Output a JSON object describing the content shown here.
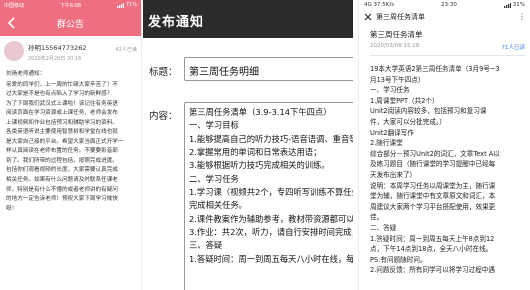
{
  "panel1": {
    "status": {
      "carrier": "中国移动",
      "time": "下午6:08",
      "battery": "71%"
    },
    "title": "群公告",
    "author": {
      "name": "孙明15564773262",
      "time": "2020年2月20日 20:16"
    },
    "read_count": "42人已读",
    "body_lines": [
      "刘旸老师通知：",
      "亲爱的同学们，上一周的忙碌大家辛苦了！不",
      "过大家是不是也有点陷入了学习的新鲜感？",
      "为了下周我们武汉式上课啦！该记住有务英语",
      "阅读页面在学习资源或上课任务，老师会发布",
      "上课视频和作业包括预习和辅助学习的资料。",
      "各类英语听说主要使用智慧树和学堂在线也就",
      "是大家自己接的平台。希望大家当面正式开学一",
      "样认真阅读在老师布置的任务。不要要影音部",
      "到了。我们所带的过程包括，按照完成进度。",
      "包括你们观看视频的长度，大家需要认真完成",
      "相关任务。如果有什么问题请及时联系任课老",
      "师。特别是有什么不懂的或者老师讲的有疑问",
      "的地方一定告诉老师！预祝大家下周学习愉快",
      "呀！"
    ]
  },
  "panel2": {
    "header": "发布通知",
    "title_label": "标题：",
    "title_value": "第三周任务明细",
    "content_label": "内容：",
    "content_lines": [
      "第三周任务清单（3.9-3.14下午四点）",
      "一、学习目标",
      "1.能够提高自己的听力技巧-语音语调、重音等；",
      "2.掌握常用的单词和日常表达用语；",
      "3.能够根据听力技巧完成相关的训练。",
      "二、学习任务",
      "1.学习课（视频共2个，专四听写训练不算任务点）-认真记",
      "完成相关任务。",
      "2.课件教案作为辅助参考，教材带资源都可以在资源区下载。",
      "3.作业：共2次，听力，请自行安排时间完成，注意截止日期",
      "三、答疑",
      "1.答疑时间：周一到周五每天八小时在线，每周会有一次问"
    ]
  },
  "panel3": {
    "status": {
      "left": "4G 37.5K/s",
      "time": "23:30",
      "battery": "31%"
    },
    "nav_title": "第三周任务清单",
    "doc_title": "第三周任务清单",
    "date": "2020/03/08 15:18",
    "readers": "71人已读",
    "body_lines": [
      "19本大学英语2第三周任务清单（3月9号~3",
      "月13号下午四点）",
      "一、学习任务",
      "1.周课堂PPT（共2个）",
      "Unit2阅读内容较多，包括预习和复习课",
      "件，大家可以分批完成。）",
      "Unit2翻译写作",
      "2.随行课堂",
      "综合部分－预习Unit2的词汇，文章Text A以",
      "及练习题目（随行课堂的学习提醒中已经每",
      "天发布出来了）",
      "说明：本周学习任务以周课堂为主，随行课",
      "堂为辅，随行课堂中有文章原文和词汇，本",
      "周建议大家两个学习平台搭配使用，效果更",
      "佳。",
      "二、答疑",
      "1.答疑时间：周一到周五每天上午8点到12",
      "点，下午14点到18点，全天八小时在线。",
      "PS:有问题随时问。",
      "2.问题反馈：所有同学可以将学习过程中遇"
    ]
  },
  "colors": {
    "pink": "#ee7080",
    "dark_header": "#2b2b2b",
    "link_blue": "#3c7be0"
  },
  "icons": [
    "back-arrow-icon",
    "signal-icon",
    "battery-icon",
    "close-icon",
    "more-icon"
  ]
}
